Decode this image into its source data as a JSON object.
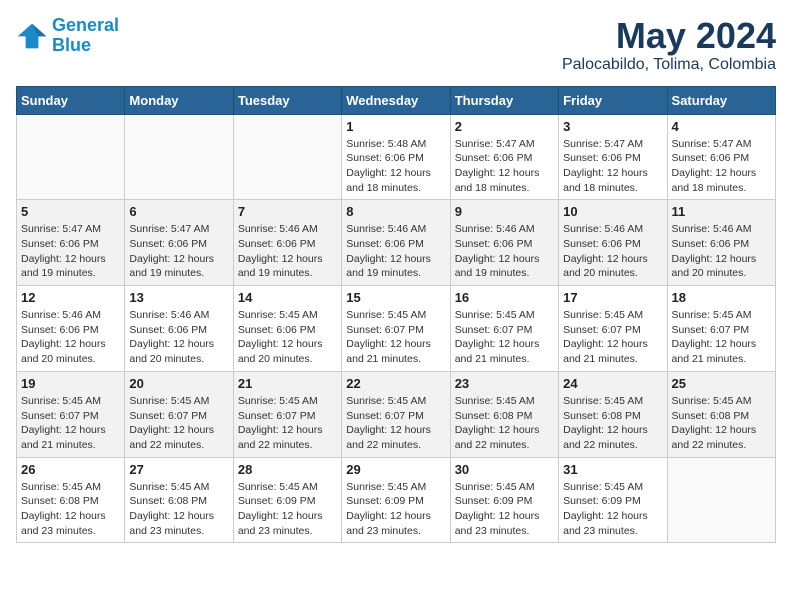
{
  "logo": {
    "line1": "General",
    "line2": "Blue"
  },
  "title": {
    "month": "May 2024",
    "location": "Palocabildo, Tolima, Colombia"
  },
  "headers": [
    "Sunday",
    "Monday",
    "Tuesday",
    "Wednesday",
    "Thursday",
    "Friday",
    "Saturday"
  ],
  "weeks": [
    [
      {
        "day": "",
        "sunrise": "",
        "sunset": "",
        "daylight": ""
      },
      {
        "day": "",
        "sunrise": "",
        "sunset": "",
        "daylight": ""
      },
      {
        "day": "",
        "sunrise": "",
        "sunset": "",
        "daylight": ""
      },
      {
        "day": "1",
        "sunrise": "Sunrise: 5:48 AM",
        "sunset": "Sunset: 6:06 PM",
        "daylight": "Daylight: 12 hours and 18 minutes."
      },
      {
        "day": "2",
        "sunrise": "Sunrise: 5:47 AM",
        "sunset": "Sunset: 6:06 PM",
        "daylight": "Daylight: 12 hours and 18 minutes."
      },
      {
        "day": "3",
        "sunrise": "Sunrise: 5:47 AM",
        "sunset": "Sunset: 6:06 PM",
        "daylight": "Daylight: 12 hours and 18 minutes."
      },
      {
        "day": "4",
        "sunrise": "Sunrise: 5:47 AM",
        "sunset": "Sunset: 6:06 PM",
        "daylight": "Daylight: 12 hours and 18 minutes."
      }
    ],
    [
      {
        "day": "5",
        "sunrise": "Sunrise: 5:47 AM",
        "sunset": "Sunset: 6:06 PM",
        "daylight": "Daylight: 12 hours and 19 minutes."
      },
      {
        "day": "6",
        "sunrise": "Sunrise: 5:47 AM",
        "sunset": "Sunset: 6:06 PM",
        "daylight": "Daylight: 12 hours and 19 minutes."
      },
      {
        "day": "7",
        "sunrise": "Sunrise: 5:46 AM",
        "sunset": "Sunset: 6:06 PM",
        "daylight": "Daylight: 12 hours and 19 minutes."
      },
      {
        "day": "8",
        "sunrise": "Sunrise: 5:46 AM",
        "sunset": "Sunset: 6:06 PM",
        "daylight": "Daylight: 12 hours and 19 minutes."
      },
      {
        "day": "9",
        "sunrise": "Sunrise: 5:46 AM",
        "sunset": "Sunset: 6:06 PM",
        "daylight": "Daylight: 12 hours and 19 minutes."
      },
      {
        "day": "10",
        "sunrise": "Sunrise: 5:46 AM",
        "sunset": "Sunset: 6:06 PM",
        "daylight": "Daylight: 12 hours and 20 minutes."
      },
      {
        "day": "11",
        "sunrise": "Sunrise: 5:46 AM",
        "sunset": "Sunset: 6:06 PM",
        "daylight": "Daylight: 12 hours and 20 minutes."
      }
    ],
    [
      {
        "day": "12",
        "sunrise": "Sunrise: 5:46 AM",
        "sunset": "Sunset: 6:06 PM",
        "daylight": "Daylight: 12 hours and 20 minutes."
      },
      {
        "day": "13",
        "sunrise": "Sunrise: 5:46 AM",
        "sunset": "Sunset: 6:06 PM",
        "daylight": "Daylight: 12 hours and 20 minutes."
      },
      {
        "day": "14",
        "sunrise": "Sunrise: 5:45 AM",
        "sunset": "Sunset: 6:06 PM",
        "daylight": "Daylight: 12 hours and 20 minutes."
      },
      {
        "day": "15",
        "sunrise": "Sunrise: 5:45 AM",
        "sunset": "Sunset: 6:07 PM",
        "daylight": "Daylight: 12 hours and 21 minutes."
      },
      {
        "day": "16",
        "sunrise": "Sunrise: 5:45 AM",
        "sunset": "Sunset: 6:07 PM",
        "daylight": "Daylight: 12 hours and 21 minutes."
      },
      {
        "day": "17",
        "sunrise": "Sunrise: 5:45 AM",
        "sunset": "Sunset: 6:07 PM",
        "daylight": "Daylight: 12 hours and 21 minutes."
      },
      {
        "day": "18",
        "sunrise": "Sunrise: 5:45 AM",
        "sunset": "Sunset: 6:07 PM",
        "daylight": "Daylight: 12 hours and 21 minutes."
      }
    ],
    [
      {
        "day": "19",
        "sunrise": "Sunrise: 5:45 AM",
        "sunset": "Sunset: 6:07 PM",
        "daylight": "Daylight: 12 hours and 21 minutes."
      },
      {
        "day": "20",
        "sunrise": "Sunrise: 5:45 AM",
        "sunset": "Sunset: 6:07 PM",
        "daylight": "Daylight: 12 hours and 22 minutes."
      },
      {
        "day": "21",
        "sunrise": "Sunrise: 5:45 AM",
        "sunset": "Sunset: 6:07 PM",
        "daylight": "Daylight: 12 hours and 22 minutes."
      },
      {
        "day": "22",
        "sunrise": "Sunrise: 5:45 AM",
        "sunset": "Sunset: 6:07 PM",
        "daylight": "Daylight: 12 hours and 22 minutes."
      },
      {
        "day": "23",
        "sunrise": "Sunrise: 5:45 AM",
        "sunset": "Sunset: 6:08 PM",
        "daylight": "Daylight: 12 hours and 22 minutes."
      },
      {
        "day": "24",
        "sunrise": "Sunrise: 5:45 AM",
        "sunset": "Sunset: 6:08 PM",
        "daylight": "Daylight: 12 hours and 22 minutes."
      },
      {
        "day": "25",
        "sunrise": "Sunrise: 5:45 AM",
        "sunset": "Sunset: 6:08 PM",
        "daylight": "Daylight: 12 hours and 22 minutes."
      }
    ],
    [
      {
        "day": "26",
        "sunrise": "Sunrise: 5:45 AM",
        "sunset": "Sunset: 6:08 PM",
        "daylight": "Daylight: 12 hours and 23 minutes."
      },
      {
        "day": "27",
        "sunrise": "Sunrise: 5:45 AM",
        "sunset": "Sunset: 6:08 PM",
        "daylight": "Daylight: 12 hours and 23 minutes."
      },
      {
        "day": "28",
        "sunrise": "Sunrise: 5:45 AM",
        "sunset": "Sunset: 6:09 PM",
        "daylight": "Daylight: 12 hours and 23 minutes."
      },
      {
        "day": "29",
        "sunrise": "Sunrise: 5:45 AM",
        "sunset": "Sunset: 6:09 PM",
        "daylight": "Daylight: 12 hours and 23 minutes."
      },
      {
        "day": "30",
        "sunrise": "Sunrise: 5:45 AM",
        "sunset": "Sunset: 6:09 PM",
        "daylight": "Daylight: 12 hours and 23 minutes."
      },
      {
        "day": "31",
        "sunrise": "Sunrise: 5:45 AM",
        "sunset": "Sunset: 6:09 PM",
        "daylight": "Daylight: 12 hours and 23 minutes."
      },
      {
        "day": "",
        "sunrise": "",
        "sunset": "",
        "daylight": ""
      }
    ]
  ]
}
